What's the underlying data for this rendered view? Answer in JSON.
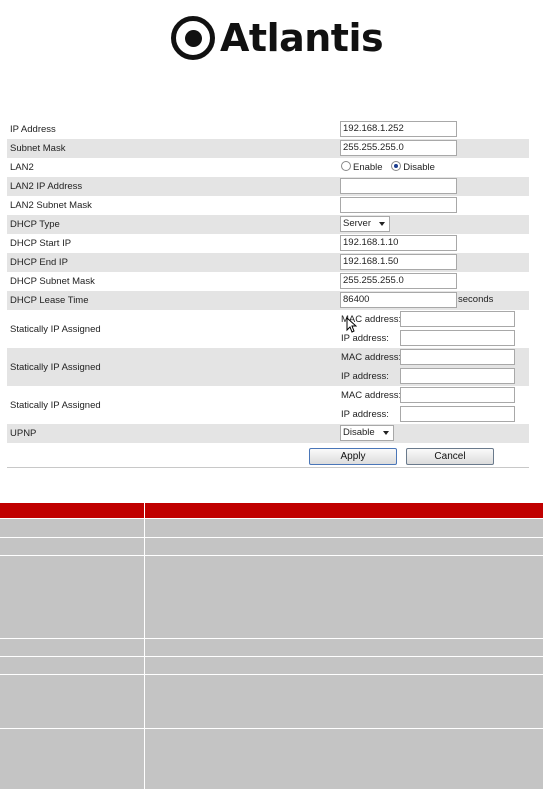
{
  "logo": {
    "text": "Atlantis"
  },
  "form": {
    "ip_address": {
      "label": "IP Address",
      "value": "192.168.1.252"
    },
    "subnet_mask": {
      "label": "Subnet Mask",
      "value": "255.255.255.0"
    },
    "lan2": {
      "label": "LAN2",
      "enable_label": "Enable",
      "disable_label": "Disable",
      "selected": "Disable"
    },
    "lan2_ip": {
      "label": "LAN2 IP Address",
      "value": ""
    },
    "lan2_mask": {
      "label": "LAN2 Subnet Mask",
      "value": ""
    },
    "dhcp_type": {
      "label": "DHCP Type",
      "value": "Server"
    },
    "dhcp_start": {
      "label": "DHCP Start IP",
      "value": "192.168.1.10"
    },
    "dhcp_end": {
      "label": "DHCP End IP",
      "value": "192.168.1.50"
    },
    "dhcp_mask": {
      "label": "DHCP Subnet Mask",
      "value": "255.255.255.0"
    },
    "lease": {
      "label": "DHCP Lease Time",
      "value": "86400",
      "unit": "seconds"
    },
    "static": [
      {
        "label": "Statically IP Assigned",
        "mac_label": "MAC address:",
        "ip_label": "IP address:"
      },
      {
        "label": "Statically IP Assigned",
        "mac_label": "MAC address:",
        "ip_label": "IP address:"
      },
      {
        "label": "Statically IP Assigned",
        "mac_label": "MAC address:",
        "ip_label": "IP address:"
      }
    ],
    "upnp": {
      "label": "UPNP",
      "value": "Disable"
    },
    "apply_label": "Apply",
    "cancel_label": "Cancel"
  },
  "colors": {
    "header_red": "#c00000",
    "row_grey": "#c4c4c4",
    "shade": "#e4e4e4"
  }
}
